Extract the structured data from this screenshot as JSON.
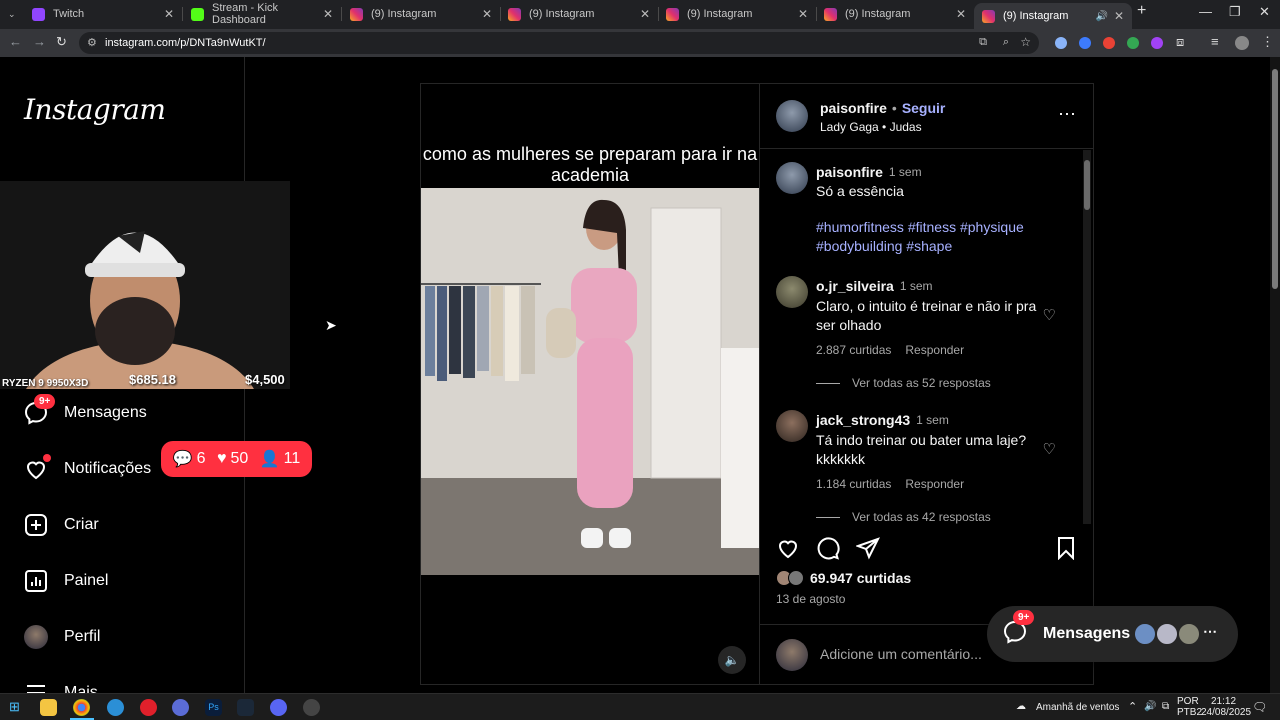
{
  "browser": {
    "tabs": [
      {
        "title": "Twitch",
        "color": "#9146ff"
      },
      {
        "title": "Stream - Kick Dashboard",
        "color": "#53fc18"
      },
      {
        "title": "(9) Instagram",
        "color": "#e1306c"
      },
      {
        "title": "(9) Instagram",
        "color": "#e1306c"
      },
      {
        "title": "(9) Instagram",
        "color": "#e1306c"
      },
      {
        "title": "(9) Instagram",
        "color": "#e1306c"
      },
      {
        "title": "(9) Instagram",
        "color": "#e1306c"
      }
    ],
    "new_tab": "+",
    "url": "instagram.com/p/DNTa9nWutKT/"
  },
  "sidebar": {
    "logo": "Instagram",
    "items": [
      {
        "label": "Mensagens",
        "icon": "messenger-icon",
        "badge": "9+"
      },
      {
        "label": "Notificações",
        "icon": "heart-icon"
      },
      {
        "label": "Criar",
        "icon": "plus-square-icon"
      },
      {
        "label": "Painel",
        "icon": "chart-icon"
      },
      {
        "label": "Perfil",
        "icon": "avatar"
      },
      {
        "label": "Mais",
        "icon": "menu-icon"
      }
    ],
    "notif_pill": {
      "comments": "6",
      "likes": "50",
      "follows": "11"
    }
  },
  "webcam": {
    "stats": [
      "RYZEN 9 9950X3D",
      "$685.18",
      "$4,500"
    ]
  },
  "post": {
    "overlay_caption": "como as mulheres se preparam para ir na academia",
    "author": "paisonfire",
    "follow": "Seguir",
    "dot": "•",
    "audio": "Lady Gaga • Judas",
    "caption": {
      "user": "paisonfire",
      "time": "1 sem",
      "text": "Só a essência",
      "hashtags": "#humorfitness #fitness #physique #bodybuilding #shape"
    },
    "comments": [
      {
        "user": "o.jr_silveira",
        "time": "1 sem",
        "text": "Claro, o intuito é treinar e não ir pra ser olhado",
        "likes": "2.887 curtidas",
        "reply": "Responder",
        "view_replies": "Ver todas as 52 respostas"
      },
      {
        "user": "jack_strong43",
        "time": "1 sem",
        "text": "Tá indo treinar ou bater uma laje?kkkkkkk",
        "likes": "1.184 curtidas",
        "reply": "Responder",
        "view_replies": "Ver todas as 42 respostas"
      }
    ],
    "likes": "69.947 curtidas",
    "date": "13 de agosto",
    "comment_placeholder": "Adicione um comentário..."
  },
  "messages_float": {
    "label": "Mensagens",
    "badge": "9+"
  },
  "taskbar": {
    "weather": "Amanhã de ventos",
    "lang": "POR",
    "layout": "PTB2",
    "time": "21:12",
    "date": "24/08/2025"
  }
}
